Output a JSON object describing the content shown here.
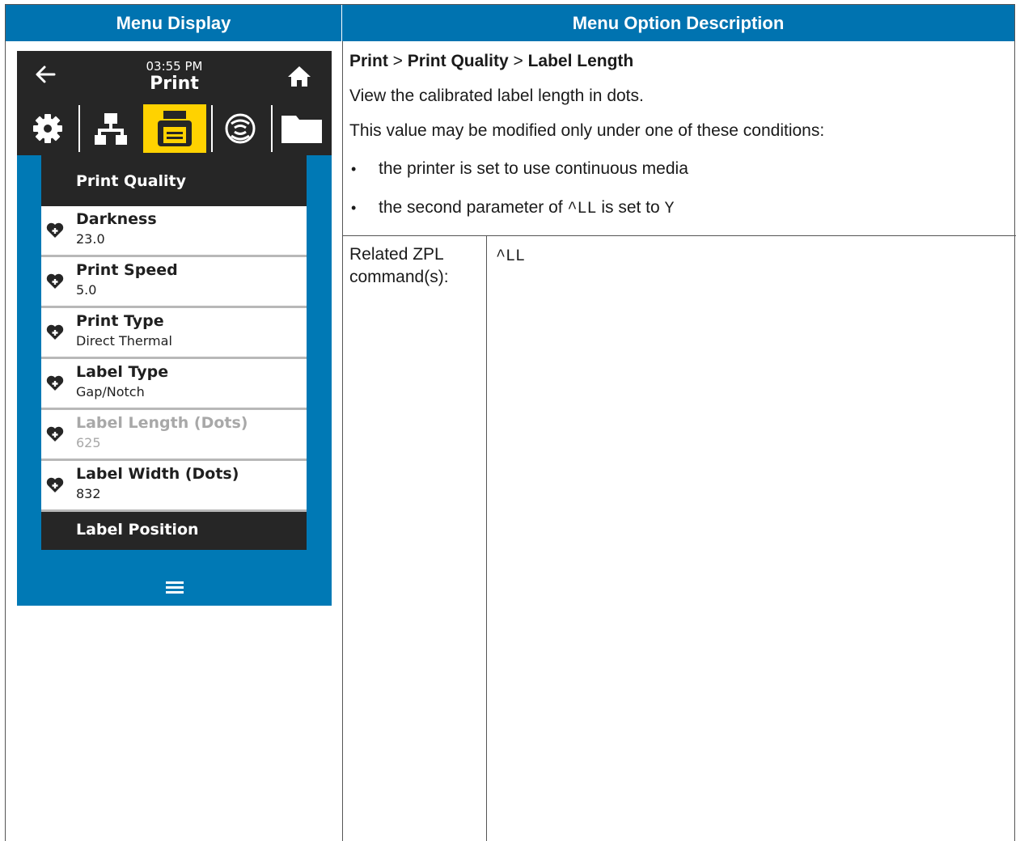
{
  "table": {
    "header_left": "Menu Display",
    "header_right": "Menu Option Description"
  },
  "device": {
    "time": "03:55 PM",
    "title": "Print",
    "icons": [
      "back-arrow-icon",
      "home-icon",
      "gear-icon",
      "network-icon",
      "printer-icon",
      "wireless-icon",
      "folder-icon",
      "heart-plus-icon",
      "hamburger-menu-icon"
    ],
    "colors": {
      "screen": "#0079b5",
      "bar": "#262626",
      "selected_tab": "#ffd200"
    },
    "section1": "Print Quality",
    "items": [
      {
        "label": "Darkness",
        "value": "23.0"
      },
      {
        "label": "Print Speed",
        "value": "5.0"
      },
      {
        "label": "Print Type",
        "value": "Direct Thermal"
      },
      {
        "label": "Label Type",
        "value": "Gap/Notch"
      },
      {
        "label": "Label Length (Dots)",
        "value": "625"
      },
      {
        "label": "Label Width (Dots)",
        "value": "832"
      }
    ],
    "section2": "Label Position"
  },
  "description": {
    "crumb1": "Print",
    "sep1": " > ",
    "crumb2": "Print Quality",
    "sep2": " > ",
    "crumb3": "Label Length",
    "line1": "View the calibrated label length in dots.",
    "line2": "This value may be modified only under one of these conditions:",
    "bullet_char": "•",
    "bullet1": "the printer is set to use continuous media",
    "bullet2_pre": "the second parameter of ",
    "bullet2_code": "^LL",
    "bullet2_mid": " is set to ",
    "bullet2_code2": "Y",
    "related_label_1": "Related ZPL",
    "related_label_2": "command(s):",
    "related_value": "^LL"
  }
}
